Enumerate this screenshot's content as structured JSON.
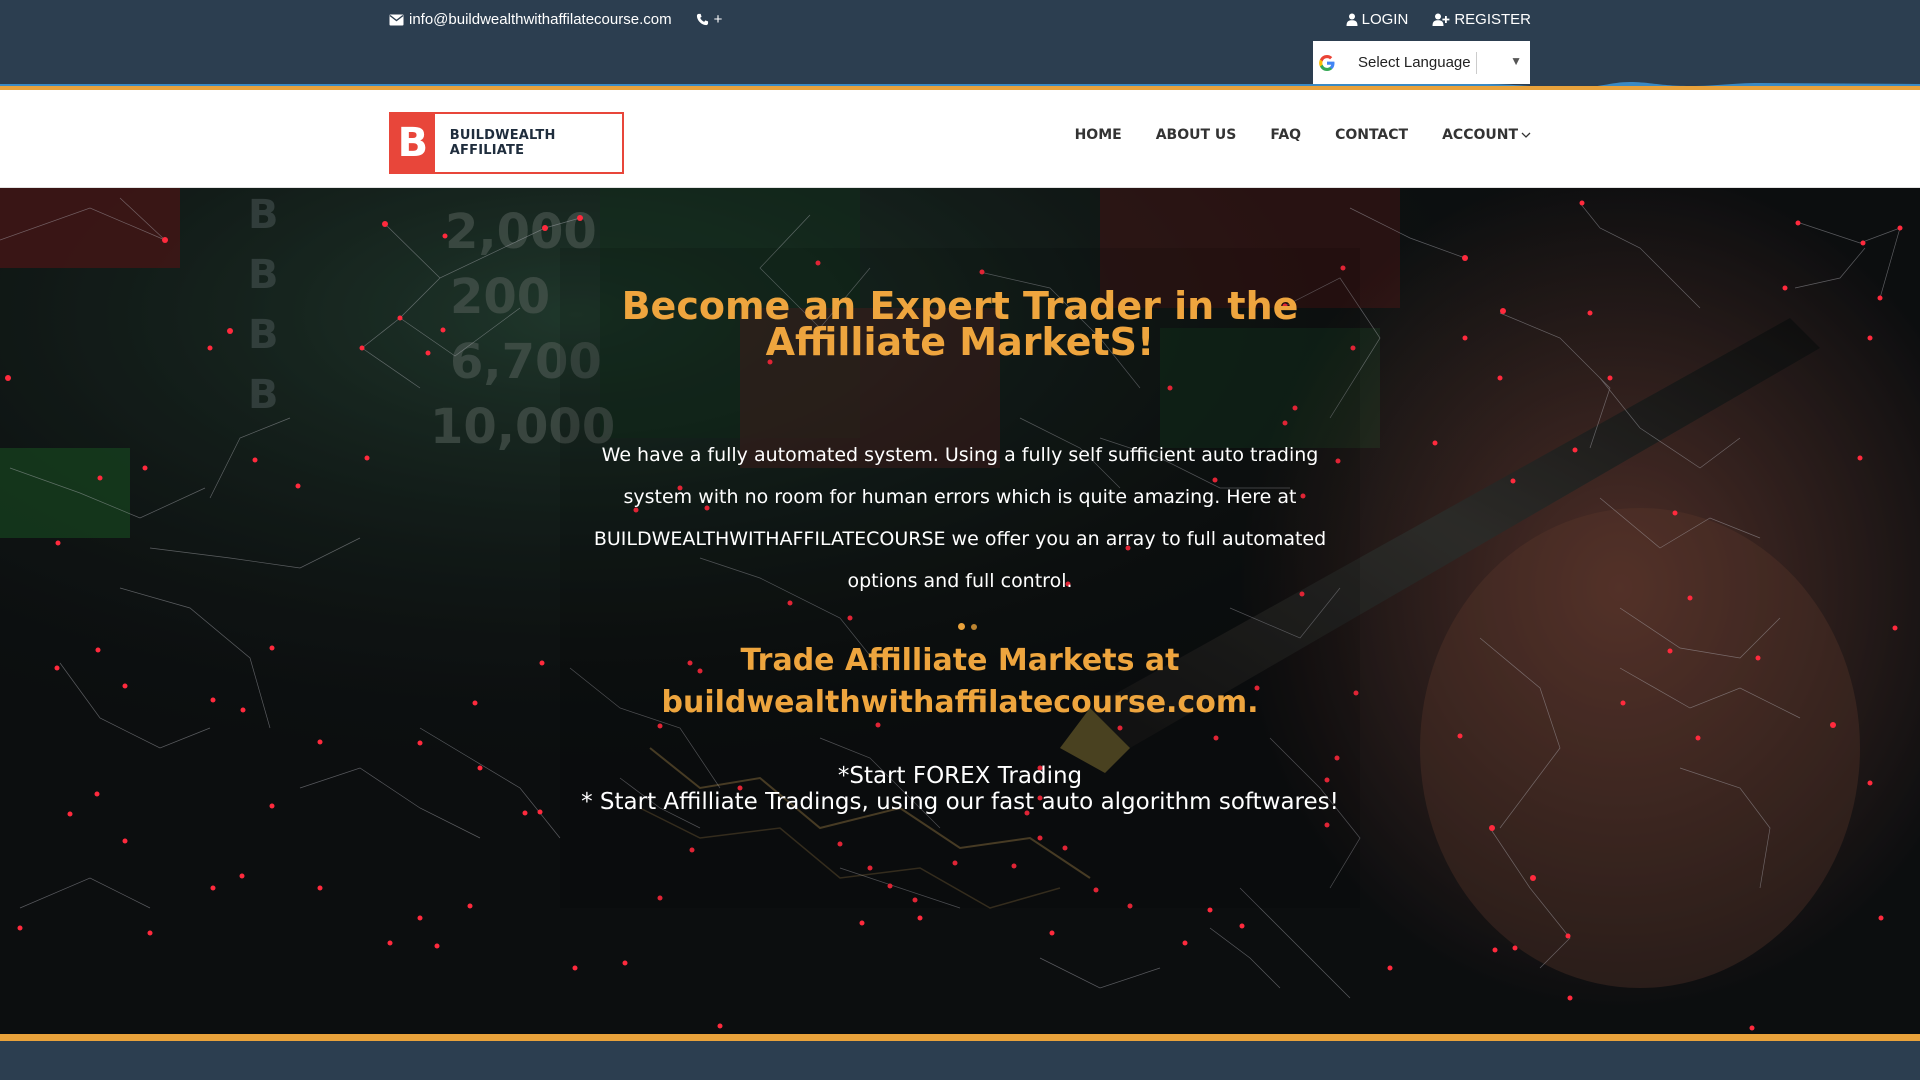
{
  "topbar": {
    "email": "info@buildwealthwithaffilatecourse.com",
    "phone": "+",
    "login_label": "LOGIN",
    "register_label": "REGISTER",
    "language_select": "Select Language"
  },
  "logo": {
    "letter": "B",
    "text": "BUILDWEALTH AFFILIATE"
  },
  "nav": {
    "items": [
      "HOME",
      "ABOUT US",
      "FAQ",
      "CONTACT",
      "ACCOUNT"
    ]
  },
  "hero": {
    "title": "Become an Expert Trader in the Affilliate MarketS!",
    "description": "We have a fully automated system. Using a fully self sufficient auto trading system with no room for human errors which is quite amazing. Here at BUILDWEALTHWITHAFFILATECOURSE we offer you an array to full automated options and full control.",
    "subtitle_line1": "Trade Affilliate Markets at",
    "subtitle_line2": "buildwealthwithaffilatecourse.com.",
    "start1": "*Start FOREX Trading",
    "start2": "* Start Affilliate Tradings, using our fast auto algorithm softwares!"
  },
  "colors": {
    "topbar_bg": "#2c3e50",
    "accent_orange": "#e9a23b",
    "heading_orange": "#eea53e",
    "logo_red": "#e8463a",
    "node_red": "#ff2a3d"
  },
  "icons": {
    "email": "envelope-icon",
    "phone": "phone-icon",
    "login": "user-icon",
    "register": "user-plus-icon",
    "google": "google-icon",
    "account_dropdown": "chevron-down-icon"
  }
}
